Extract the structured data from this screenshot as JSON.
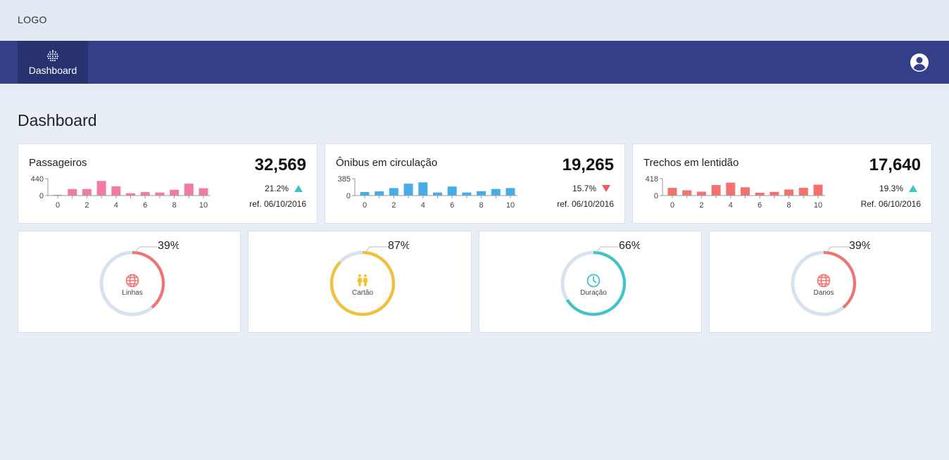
{
  "header": {
    "logo": "LOGO"
  },
  "nav": {
    "dashboard_label": "Dashboard"
  },
  "page": {
    "title": "Dashboard"
  },
  "colors": {
    "pink": "#f27aa6",
    "blue": "#46aee6",
    "salmon": "#f47170",
    "yellow": "#f6c12e",
    "teal": "#3ec4c4",
    "track": "#d8e2ef",
    "nav": "#333f88"
  },
  "stats": [
    {
      "title": "Passageiros",
      "value": "32,569",
      "change": "21.2%",
      "trend": "up",
      "ref": "ref. 06/10/2016",
      "color": "pink",
      "ymax_label": "440",
      "ymin_label": "0",
      "ticks": [
        "0",
        "2",
        "4",
        "6",
        "8",
        "10"
      ],
      "chart_data": {
        "type": "bar",
        "x": [
          0,
          1,
          2,
          3,
          4,
          5,
          6,
          7,
          8,
          9,
          10
        ],
        "values": [
          20,
          170,
          170,
          380,
          240,
          60,
          90,
          80,
          150,
          310,
          190
        ],
        "ylim": [
          0,
          440
        ]
      }
    },
    {
      "title": "Ônibus em circulação",
      "value": "19,265",
      "change": "15.7%",
      "trend": "down",
      "ref": "ref. 06/10/2016",
      "color": "blue",
      "ymax_label": "385",
      "ymin_label": "0",
      "ticks": [
        "0",
        "2",
        "4",
        "6",
        "8",
        "10"
      ],
      "chart_data": {
        "type": "bar",
        "x": [
          0,
          1,
          2,
          3,
          4,
          5,
          6,
          7,
          8,
          9,
          10
        ],
        "values": [
          80,
          95,
          170,
          270,
          300,
          70,
          205,
          70,
          100,
          150,
          170
        ],
        "ylim": [
          0,
          385
        ]
      }
    },
    {
      "title": "Trechos em lentidão",
      "value": "17,640",
      "change": "19.3%",
      "trend": "up",
      "ref": "Ref. 06/10/2016",
      "color": "salmon",
      "ymax_label": "418",
      "ymin_label": "0",
      "ticks": [
        "0",
        "2",
        "4",
        "6",
        "8",
        "10"
      ],
      "chart_data": {
        "type": "bar",
        "x": [
          0,
          1,
          2,
          3,
          4,
          5,
          6,
          7,
          8,
          9,
          10
        ],
        "values": [
          190,
          130,
          95,
          260,
          320,
          205,
          70,
          90,
          150,
          190,
          270
        ],
        "ylim": [
          0,
          418
        ]
      }
    }
  ],
  "gauges": [
    {
      "label": "Linhas",
      "percent": 39,
      "percent_text": "39%",
      "color": "salmon",
      "icon": "globe-icon"
    },
    {
      "label": "Cartão",
      "percent": 87,
      "percent_text": "87%",
      "color": "yellow",
      "icon": "people-icon"
    },
    {
      "label": "Duração",
      "percent": 66,
      "percent_text": "66%",
      "color": "teal",
      "icon": "clock-icon"
    },
    {
      "label": "Danos",
      "percent": 39,
      "percent_text": "39%",
      "color": "salmon",
      "icon": "globe-icon"
    }
  ]
}
